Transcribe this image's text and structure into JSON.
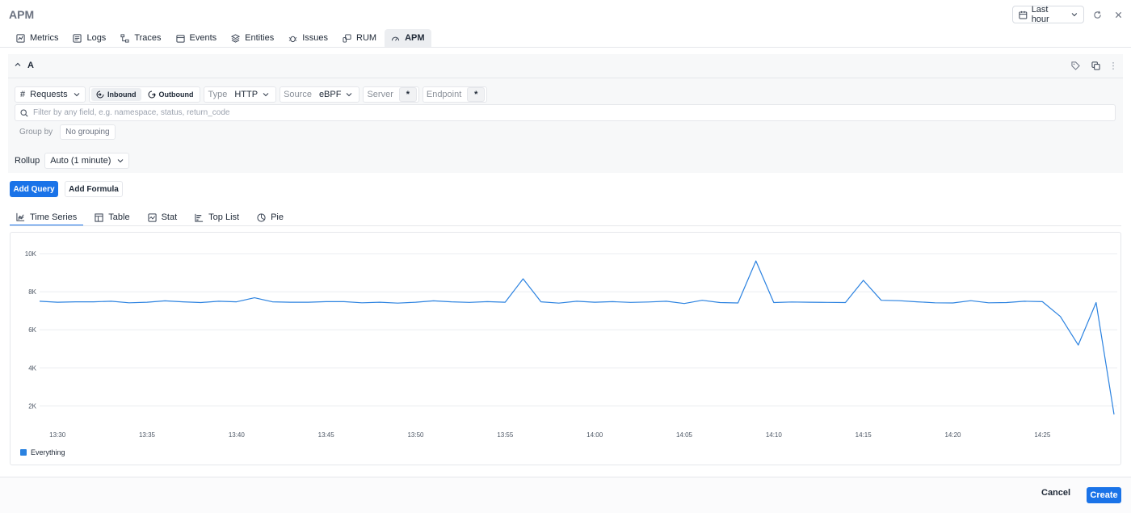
{
  "app": {
    "title": "APM"
  },
  "header": {
    "time_range": "Last hour"
  },
  "tabs": [
    {
      "label": "Metrics",
      "icon": "metrics-icon"
    },
    {
      "label": "Logs",
      "icon": "logs-icon"
    },
    {
      "label": "Traces",
      "icon": "traces-icon"
    },
    {
      "label": "Events",
      "icon": "events-icon"
    },
    {
      "label": "Entities",
      "icon": "entities-icon"
    },
    {
      "label": "Issues",
      "icon": "issues-icon"
    },
    {
      "label": "RUM",
      "icon": "rum-icon"
    },
    {
      "label": "APM",
      "icon": "apm-icon",
      "active": true
    }
  ],
  "query": {
    "name": "A",
    "metric_prefix": "#",
    "metric": "Requests",
    "direction": {
      "inbound": "Inbound",
      "outbound": "Outbound",
      "selected": "Inbound"
    },
    "type_label": "Type",
    "type_value": "HTTP",
    "source_label": "Source",
    "source_value": "eBPF",
    "server_label": "Server",
    "server_value": "*",
    "endpoint_label": "Endpoint",
    "endpoint_value": "*",
    "filter_placeholder": "Filter by any field, e.g. namespace, status, return_code",
    "group_by_label": "Group by",
    "group_by_value": "No grouping"
  },
  "rollup": {
    "label": "Rollup",
    "value": "Auto (1 minute)"
  },
  "actions": {
    "add_query": "Add Query",
    "add_formula": "Add Formula"
  },
  "viz_tabs": [
    {
      "label": "Time Series",
      "active": true
    },
    {
      "label": "Table"
    },
    {
      "label": "Stat"
    },
    {
      "label": "Top List"
    },
    {
      "label": "Pie"
    }
  ],
  "chart_data": {
    "type": "line",
    "ylim": [
      1000,
      10000
    ],
    "y_ticks": [
      2000,
      4000,
      6000,
      8000,
      10000
    ],
    "y_tick_labels": [
      "2K",
      "4K",
      "6K",
      "8K",
      "10K"
    ],
    "x_tick_labels": [
      "13:30",
      "13:35",
      "13:40",
      "13:45",
      "13:50",
      "13:55",
      "14:00",
      "14:05",
      "14:10",
      "14:15",
      "14:20",
      "14:25"
    ],
    "x_start": "13:29",
    "x_step_minutes": 1,
    "grid": true,
    "legend_position": "bottom-left",
    "series": [
      {
        "name": "Everything",
        "color": "#2b82e0",
        "values": [
          7500,
          7450,
          7470,
          7470,
          7500,
          7420,
          7450,
          7520,
          7470,
          7430,
          7500,
          7470,
          7680,
          7470,
          7450,
          7450,
          7480,
          7480,
          7420,
          7450,
          7400,
          7450,
          7520,
          7470,
          7440,
          7480,
          7450,
          8680,
          7470,
          7400,
          7500,
          7450,
          7480,
          7440,
          7460,
          7500,
          7380,
          7550,
          7430,
          7410,
          9620,
          7430,
          7460,
          7450,
          7440,
          7430,
          8600,
          7550,
          7530,
          7470,
          7420,
          7410,
          7530,
          7420,
          7430,
          7500,
          7480,
          6700,
          5200,
          7430,
          1550
        ]
      }
    ]
  },
  "footer": {
    "cancel": "Cancel",
    "create": "Create"
  }
}
